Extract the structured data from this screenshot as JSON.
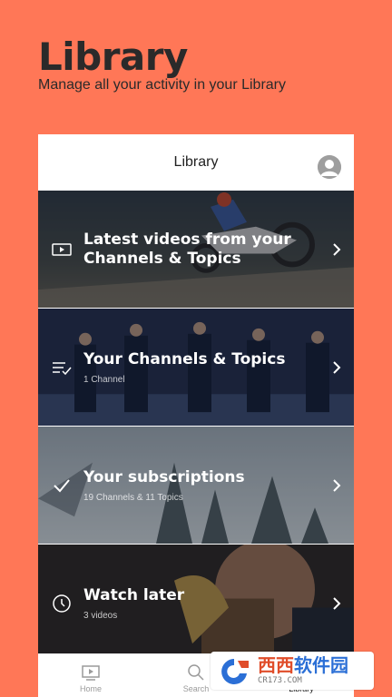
{
  "promo": {
    "title": "Library",
    "subtitle": "Manage all your activity in your Library"
  },
  "app": {
    "header_title": "Library",
    "rows": [
      {
        "title": "Latest videos from your Channels & Topics",
        "subtitle": "",
        "icon": "play-box-icon"
      },
      {
        "title": "Your Channels & Topics",
        "subtitle": "1 Channel",
        "icon": "playlist-check-icon"
      },
      {
        "title": "Your subscriptions",
        "subtitle": "19 Channels & 11 Topics",
        "icon": "check-icon"
      },
      {
        "title": "Watch later",
        "subtitle": "3 videos",
        "icon": "clock-icon"
      }
    ],
    "bottom_nav": [
      {
        "label": "Home",
        "icon": "tv-icon",
        "active": false
      },
      {
        "label": "Search",
        "icon": "search-icon",
        "active": false
      },
      {
        "label": "Library",
        "icon": "library-icon",
        "active": true
      }
    ]
  },
  "watermark": {
    "brand_part1": "西西",
    "brand_part2": "软件园",
    "url": "CR173.COM"
  },
  "colors": {
    "background": "#FF7757",
    "watermark_red": "#e04d2a",
    "watermark_blue": "#2b6fd6"
  }
}
